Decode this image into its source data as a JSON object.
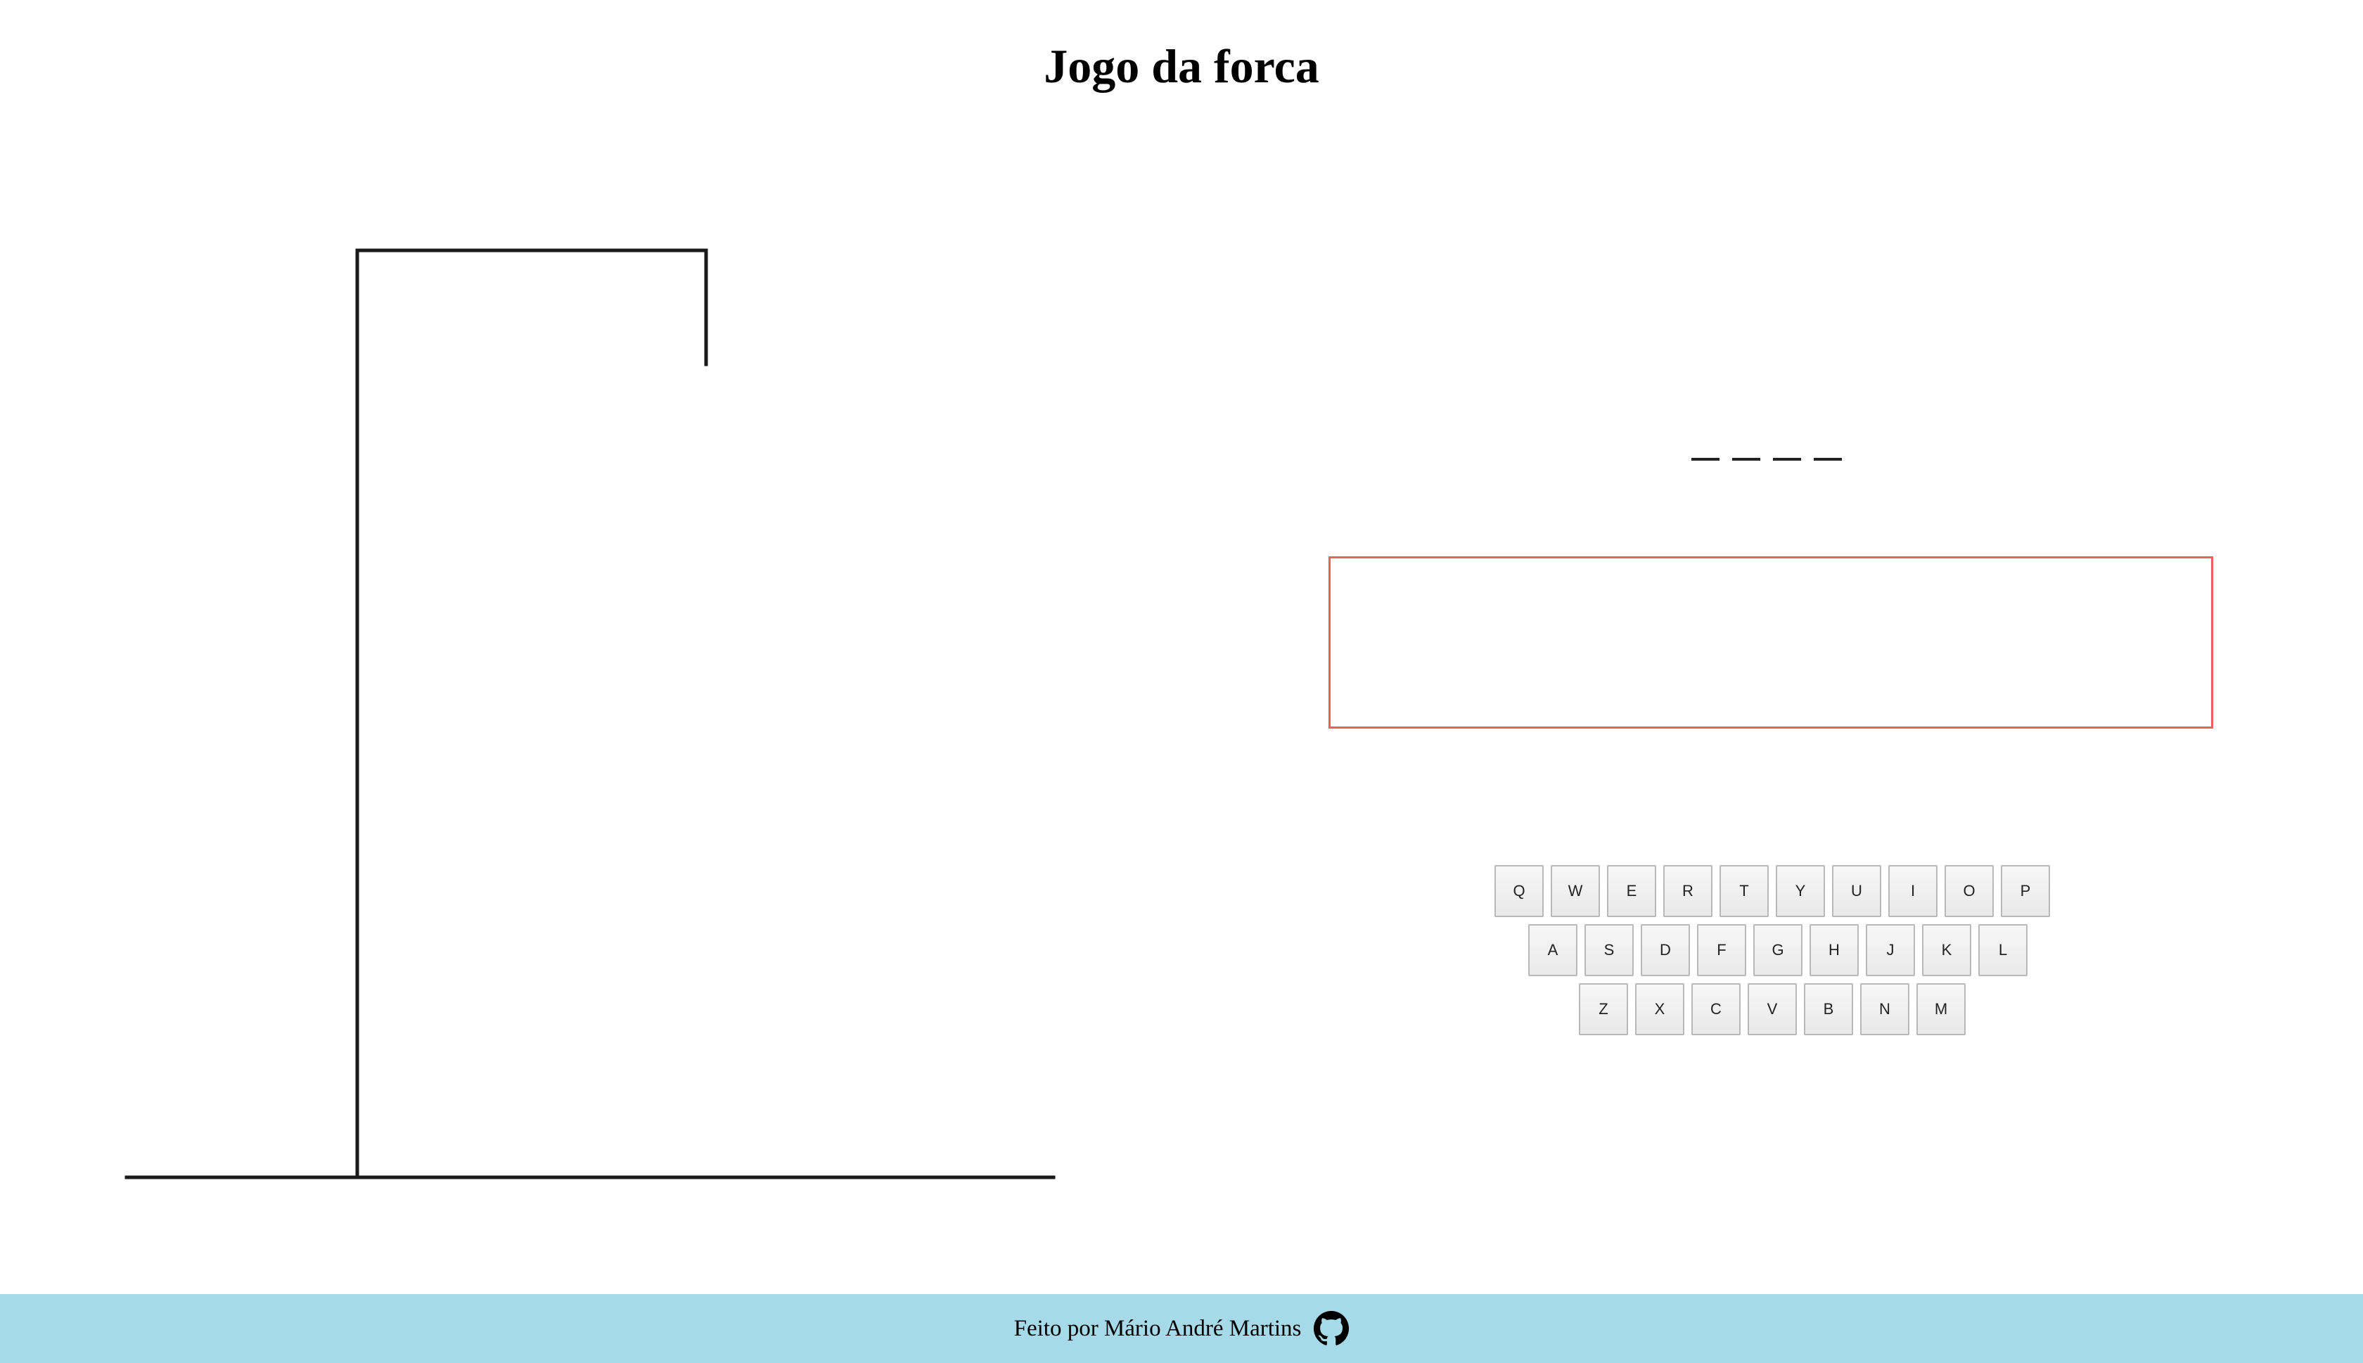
{
  "title": "Jogo da forca",
  "word": {
    "slots": 4
  },
  "keyboard": {
    "rows": [
      [
        "Q",
        "W",
        "E",
        "R",
        "T",
        "Y",
        "U",
        "I",
        "O",
        "P"
      ],
      [
        "A",
        "S",
        "D",
        "F",
        "G",
        "H",
        "J",
        "K",
        "L"
      ],
      [
        "Z",
        "X",
        "C",
        "V",
        "B",
        "N",
        "M"
      ]
    ]
  },
  "message": {
    "text": "",
    "border_color": "#e8605f"
  },
  "footer": {
    "text": "Feito por Mário André Martins",
    "icon": "github-icon",
    "background": "#a6dae9"
  }
}
